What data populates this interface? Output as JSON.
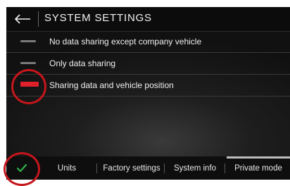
{
  "header": {
    "back_icon": "arrow-left-icon",
    "title": "SYSTEM SETTINGS"
  },
  "options": [
    {
      "label": "No data sharing except company vehicle",
      "selected": false
    },
    {
      "label": "Only data sharing",
      "selected": false
    },
    {
      "label": "Sharing data and vehicle position",
      "selected": true
    }
  ],
  "bottom_bar": {
    "confirm_icon": "checkmark-icon",
    "tabs": [
      {
        "label": "Units",
        "active": false
      },
      {
        "label": "Factory settings",
        "active": false
      },
      {
        "label": "System info",
        "active": false
      },
      {
        "label": "Private mode",
        "active": true
      }
    ]
  },
  "colors": {
    "selected_indicator": "#e0202a",
    "confirm_check": "#2fb34a",
    "highlight_ring": "#c5161c"
  }
}
